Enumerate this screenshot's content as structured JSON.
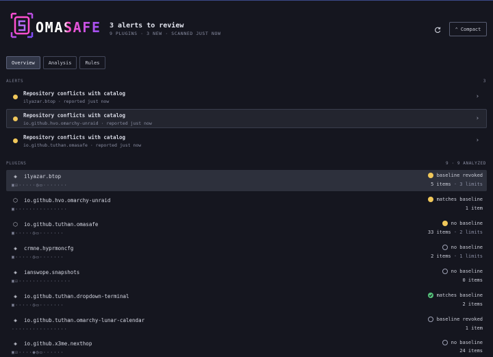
{
  "app": {
    "logo_text": "OMASAFE",
    "title": "3 alerts to review",
    "subtitle": "9 PLUGINS · 3 NEW · SCANNED JUST NOW",
    "compact_label": "Compact"
  },
  "tabs": [
    {
      "label": "Overview",
      "active": true
    },
    {
      "label": "Analysis",
      "active": false
    },
    {
      "label": "Rules",
      "active": false
    }
  ],
  "alerts": {
    "label": "ALERTS",
    "count": "3",
    "items": [
      {
        "title": "Repository conflicts with catalog",
        "sub": "ilyazar.btop · reported just now"
      },
      {
        "title": "Repository conflicts with catalog",
        "sub": "io.github.hvo.omarchy-unraid · reported just now"
      },
      {
        "title": "Repository conflicts with catalog",
        "sub": "io.github.tuthan.omasafe · reported just now"
      }
    ]
  },
  "plugins": {
    "label": "PLUGINS",
    "count": "9 · 9 ANALYZED",
    "items": [
      {
        "icon": "git-icon",
        "name": "ilyazar.btop",
        "caps": "▣☑·····◷▭·······",
        "status": "baseline revoked",
        "dot": "warn",
        "count": "5 items",
        "limits": " · 3 limits"
      },
      {
        "icon": "package-icon",
        "name": "io.github.hvo.omarchy-unraid",
        "caps": "▣···············",
        "status": "matches baseline",
        "dot": "warn",
        "count": "1 item",
        "limits": ""
      },
      {
        "icon": "package-icon",
        "name": "io.github.tuthan.omasafe",
        "caps": "▣·····◷▭·······",
        "status": "no baseline",
        "dot": "warn",
        "count": "33 items",
        "limits": " · 2 limits"
      },
      {
        "icon": "git-icon",
        "name": "crmne.hyprmoncfg",
        "caps": "▣·····◷▭·······",
        "status": "no baseline",
        "dot": "none",
        "count": "2 items",
        "limits": " · 1 limits"
      },
      {
        "icon": "git-icon",
        "name": "ianswope.snapshots",
        "caps": "▣☑···············",
        "status": "no baseline",
        "dot": "none",
        "count": "0 items",
        "limits": ""
      },
      {
        "icon": "git-icon",
        "name": "io.github.tuthan.dropdown-terminal",
        "caps": "▣·····◷▭·······",
        "status": "matches baseline",
        "dot": "ok",
        "count": "2 items",
        "limits": ""
      },
      {
        "icon": "git-icon",
        "name": "io.github.tuthan.omarchy-lunar-calendar",
        "caps": "················",
        "status": "baseline revoked",
        "dot": "none",
        "count": "1 item",
        "limits": ""
      },
      {
        "icon": "git-icon",
        "name": "io.github.x3me.nexthop",
        "caps": "▣☑····◉◷▭······",
        "status": "no baseline",
        "dot": "none",
        "count": "24 items",
        "limits": ""
      }
    ]
  },
  "colors": {
    "accent_pink": "#e040d8",
    "accent_purple": "#8a4cf0",
    "warn": "#f0c75a",
    "ok": "#55c27a"
  }
}
